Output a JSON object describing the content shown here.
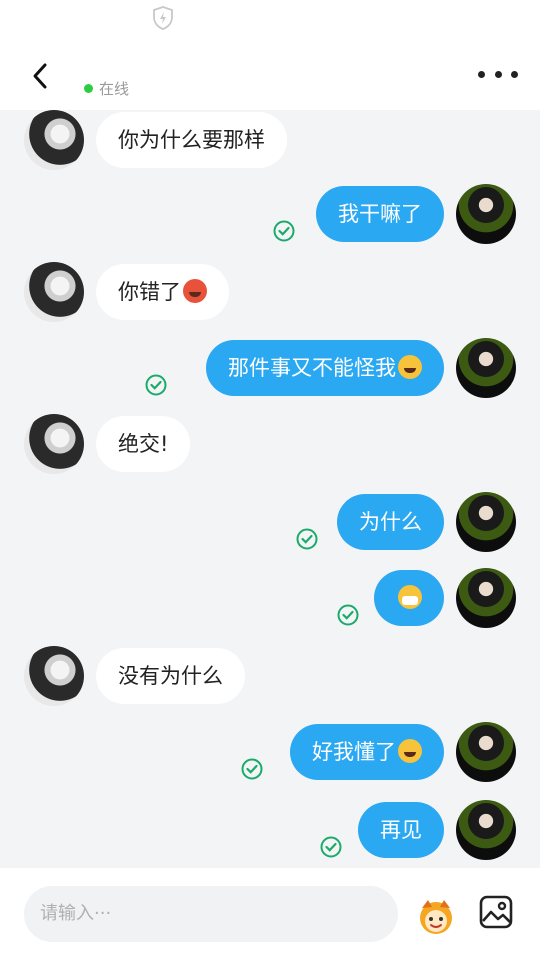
{
  "status": {
    "shield_icon": "shield-bolt-icon"
  },
  "header": {
    "back_icon": "chevron-left-icon",
    "online_text": "在线",
    "more_icon": "more-horizontal-icon"
  },
  "messages": [
    {
      "side": "in",
      "text": "你为什么要那样"
    },
    {
      "side": "out",
      "text": "我干嘛了",
      "read": true
    },
    {
      "side": "in",
      "text": "你错了",
      "emoji": "angry-face-emoji"
    },
    {
      "side": "out",
      "text": "那件事又不能怪我",
      "emoji": "laughing-tears-emoji",
      "read": true
    },
    {
      "side": "in",
      "text": "绝交!"
    },
    {
      "side": "out",
      "text": "为什么",
      "read": true
    },
    {
      "side": "out",
      "text": "",
      "emoji": "mask-face-emoji",
      "read": true
    },
    {
      "side": "in",
      "text": "没有为什么"
    },
    {
      "side": "out",
      "text": "好我懂了",
      "emoji": "crying-face-emoji",
      "read": true
    },
    {
      "side": "out",
      "text": "再见",
      "read": true
    }
  ],
  "input": {
    "placeholder": "请输入···",
    "sticker_icon": "sticker-face-icon",
    "image_icon": "image-icon"
  },
  "colors": {
    "outgoing_bubble": "#2aa8f2",
    "incoming_bubble": "#ffffff",
    "read_check": "#1aaa6a",
    "online_dot": "#2ecc40"
  }
}
